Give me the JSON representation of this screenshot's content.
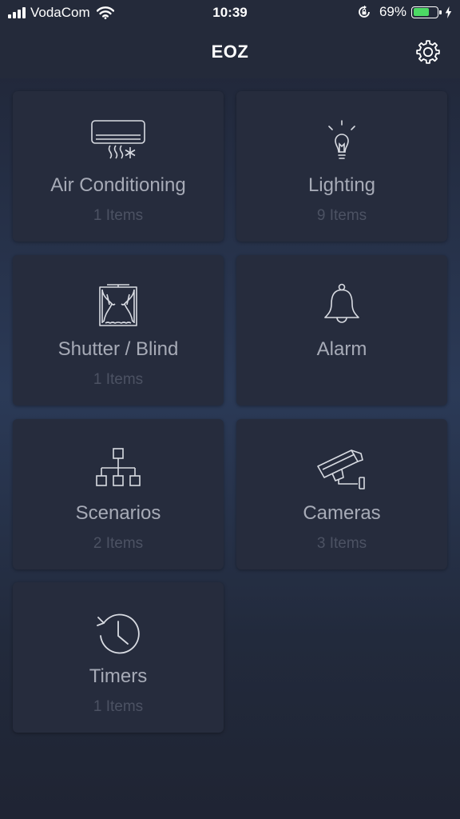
{
  "status_bar": {
    "carrier": "VodaCom",
    "time": "10:39",
    "battery_percent": "69%",
    "battery_level": 0.69,
    "icons": [
      "signal-icon",
      "wifi-icon",
      "rotation-lock-icon",
      "battery-icon",
      "charging-bolt-icon"
    ]
  },
  "navbar": {
    "title": "EOZ",
    "settings_icon": "gear-icon"
  },
  "colors": {
    "tile_background": "#262c3d",
    "label": "#a7abb7",
    "count": "#4c5263",
    "battery_fill": "#4cd964"
  },
  "tiles": [
    {
      "label": "Air Conditioning",
      "count": "1 Items",
      "icon": "air-conditioner-icon"
    },
    {
      "label": "Lighting",
      "count": "9 Items",
      "icon": "light-bulb-icon"
    },
    {
      "label": "Shutter / Blind",
      "count": "1 Items",
      "icon": "curtain-icon"
    },
    {
      "label": "Alarm",
      "count": "",
      "icon": "bell-icon"
    },
    {
      "label": "Scenarios",
      "count": "2 Items",
      "icon": "hierarchy-icon"
    },
    {
      "label": "Cameras",
      "count": "3 Items",
      "icon": "security-camera-icon"
    },
    {
      "label": "Timers",
      "count": "1 Items",
      "icon": "timer-clock-icon"
    }
  ]
}
